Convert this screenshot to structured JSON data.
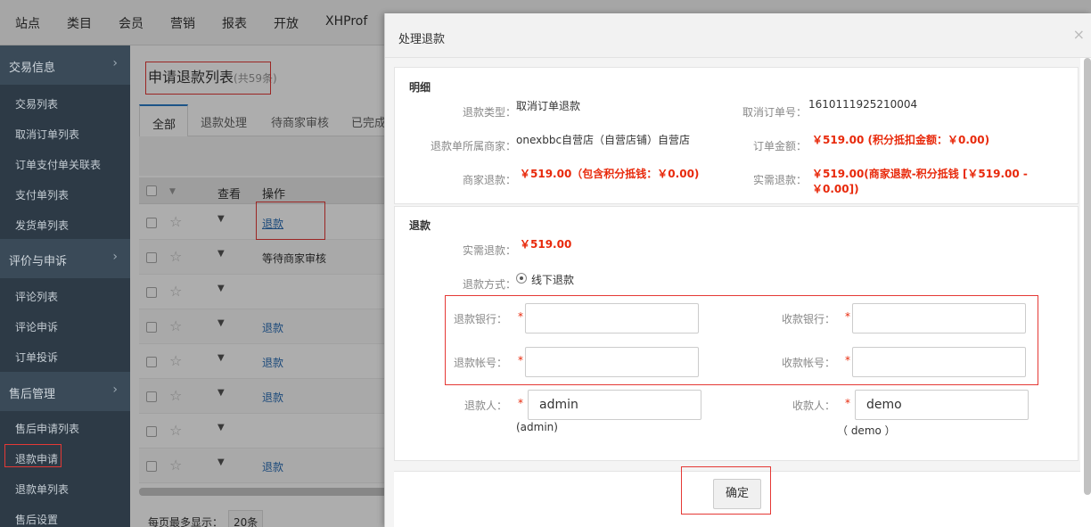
{
  "topnav": [
    "站点",
    "类目",
    "会员",
    "营销",
    "报表",
    "开放",
    "XHProf"
  ],
  "sidebar": {
    "groups": [
      {
        "label": "交易信息",
        "items": [
          "交易列表",
          "取消订单列表",
          "订单支付单关联表",
          "支付单列表",
          "发货单列表"
        ]
      },
      {
        "label": "评价与申诉",
        "items": [
          "评论列表",
          "评论申诉",
          "订单投诉"
        ]
      },
      {
        "label": "售后管理",
        "items": [
          "售后申请列表",
          "退款申请",
          "退款单列表",
          "售后设置"
        ]
      }
    ]
  },
  "list": {
    "title": "申请退款列表",
    "count": "(共59条)",
    "tabs": [
      "全部",
      "退款处理",
      "待商家审核",
      "已完成"
    ],
    "headers": {
      "view": "查看",
      "op": "操作"
    },
    "rows": [
      "退款",
      "等待商家审核",
      "",
      "退款",
      "退款",
      "退款",
      "",
      "退款"
    ],
    "pager_label": "每页最多显示：",
    "pager_value": "20条"
  },
  "modal": {
    "title": "处理退款",
    "close": "×",
    "detail": {
      "title": "明细",
      "refund_type_label": "退款类型：",
      "refund_type": "取消订单退款",
      "cancel_no_label": "取消订单号：",
      "cancel_no": "1610111925210004",
      "merchant_label": "退款单所属商家：",
      "merchant": "onexbbc自营店（自营店铺）自营店",
      "order_amount_label": "订单金额：",
      "order_amount": "￥519.00 (积分抵扣金额：￥0.00)",
      "merchant_refund_label": "商家退款：",
      "merchant_refund": "￥519.00（包含积分抵钱：￥0.00)",
      "actual_refund_label": "实需退款：",
      "actual_refund": "￥519.00(商家退款-积分抵钱 [￥519.00 - ￥0.00])"
    },
    "refund": {
      "title": "退款",
      "actual_label": "实需退款：",
      "actual": "￥519.00",
      "method_label": "退款方式：",
      "method": "线下退款",
      "refund_bank_label": "退款银行：",
      "receive_bank_label": "收款银行：",
      "refund_account_label": "退款帐号：",
      "receive_account_label": "收款帐号：",
      "refunder_label": "退款人：",
      "refunder": "admin",
      "refunder_note": "(admin)",
      "receiver_label": "收款人：",
      "receiver": "demo",
      "receiver_note": "（ demo ）",
      "required": "*"
    },
    "confirm": "确定"
  }
}
